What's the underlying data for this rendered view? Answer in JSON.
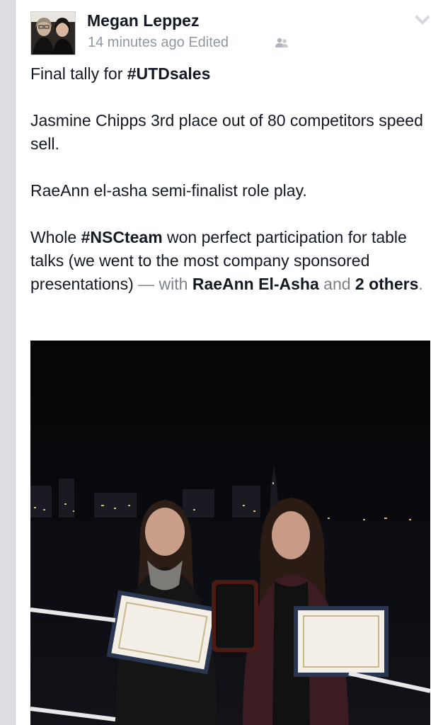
{
  "post": {
    "author": "Megan Leppez",
    "timestamp": "14 minutes ago",
    "edited": "Edited",
    "audience_icon": "friends-icon",
    "menu_icon": "chevron-down-icon",
    "lines": {
      "l1_prefix": "Final tally for ",
      "l1_hashtag": "#UTDsales",
      "l2": "Jasmine Chipps 3rd place out of 80 competitors speed sell.",
      "l3": "RaeAnn el-asha semi-finalist role play.",
      "l4_prefix": "Whole ",
      "l4_hashtag": "#NSCteam",
      "l4_text": " won perfect participation for table talks (we went to the most company sponsored presentations)",
      "with_dash": " — with ",
      "tag1": "RaeAnn El-Asha",
      "and_word": " and ",
      "tag2": "2 others",
      "period": "."
    }
  }
}
